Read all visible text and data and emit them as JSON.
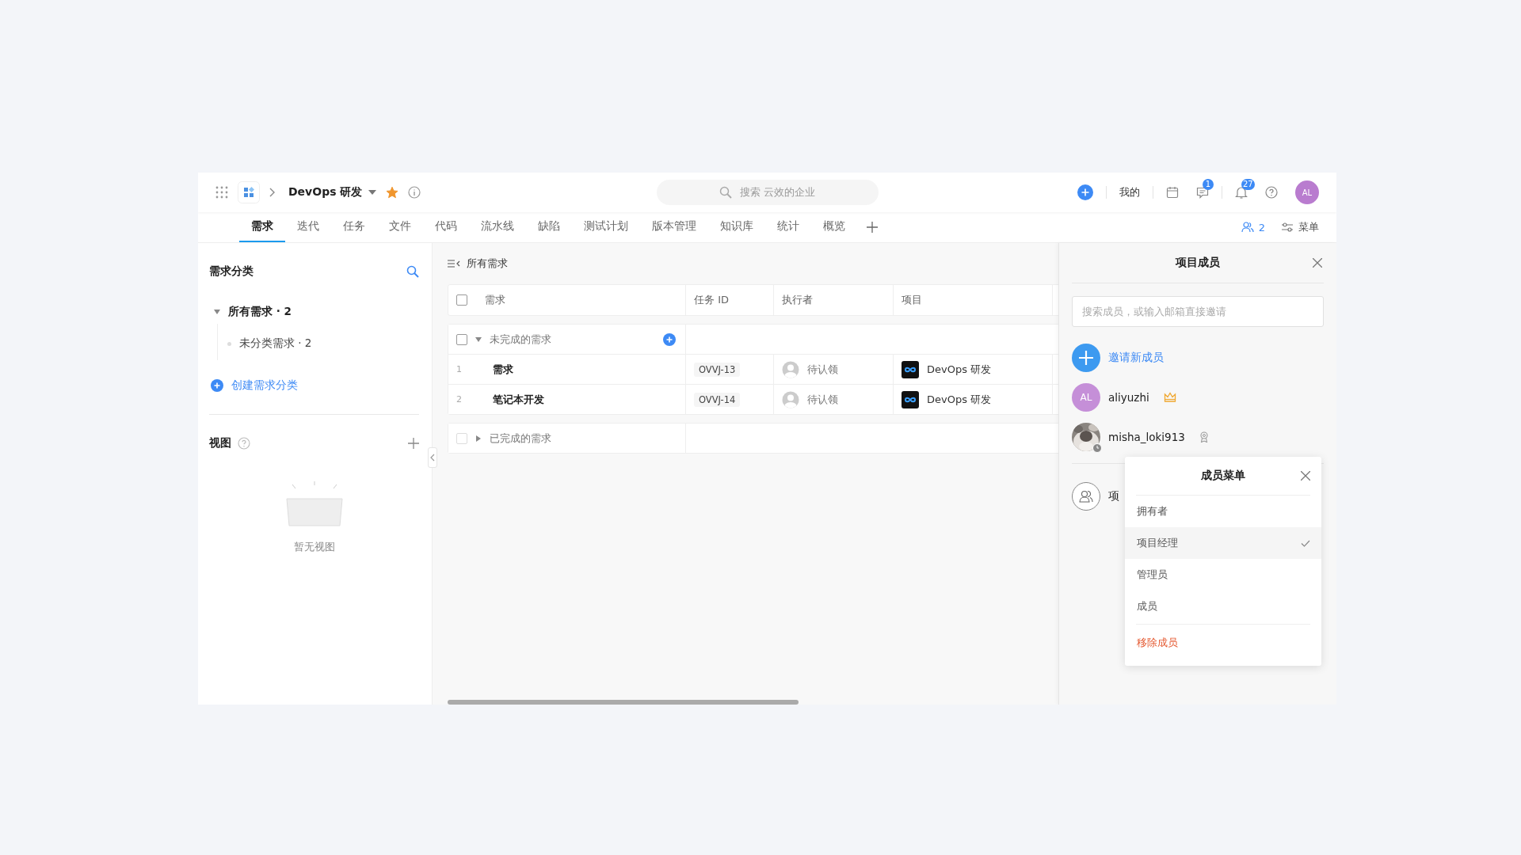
{
  "header": {
    "project": "DevOps 研发",
    "starred": true,
    "search_placeholder": "搜索 云效的企业",
    "my_label": "我的",
    "message_badge": "1",
    "notification_badge": "27",
    "avatar": "AL"
  },
  "tabs": [
    {
      "label": "需求",
      "selected": true
    },
    {
      "label": "迭代",
      "selected": false
    },
    {
      "label": "任务",
      "selected": false
    },
    {
      "label": "文件",
      "selected": false
    },
    {
      "label": "代码",
      "selected": false
    },
    {
      "label": "流水线",
      "selected": false
    },
    {
      "label": "缺陷",
      "selected": false
    },
    {
      "label": "测试计划",
      "selected": false
    },
    {
      "label": "版本管理",
      "selected": false
    },
    {
      "label": "知识库",
      "selected": false
    },
    {
      "label": "统计",
      "selected": false
    },
    {
      "label": "概览",
      "selected": false
    }
  ],
  "tab_tools": {
    "member_count": "2",
    "menu_label": "菜单"
  },
  "sidebar": {
    "title": "需求分类",
    "tree": [
      {
        "label": "所有需求 · 2",
        "expanded": true,
        "children": [
          {
            "label": "未分类需求 · 2"
          }
        ]
      }
    ],
    "create_label": "创建需求分类",
    "views_title": "视图",
    "views_empty": "暂无视图"
  },
  "main": {
    "title": "所有需求",
    "columns": [
      "需求",
      "任务 ID",
      "执行者",
      "项目"
    ],
    "all_checked": false,
    "groups": [
      {
        "label": "未完成的需求",
        "expanded": true,
        "checked": false,
        "rows": [
          {
            "index": "1",
            "title": "需求",
            "task_id": "OVVJ-13",
            "assignee": "待认领",
            "project": "DevOps 研发"
          },
          {
            "index": "2",
            "title": "笔记本开发",
            "task_id": "OVVJ-14",
            "assignee": "待认领",
            "project": "DevOps 研发"
          }
        ]
      },
      {
        "label": "已完成的需求",
        "expanded": false,
        "checked": false
      }
    ]
  },
  "members_panel": {
    "title": "项目成员",
    "search_placeholder": "搜索成员，或输入邮箱直接邀请",
    "invite_label": "邀请新成员",
    "members": [
      {
        "name": "aliyuzhi",
        "kind": "initials",
        "initials": "AL",
        "owner": true
      },
      {
        "name": "misha_loki913",
        "kind": "picture",
        "owner": false
      }
    ],
    "group_label": "项"
  },
  "member_menu": {
    "title": "成员菜单",
    "roles": [
      {
        "label": "拥有者",
        "selected": false
      },
      {
        "label": "项目经理",
        "selected": true
      },
      {
        "label": "管理员",
        "selected": false
      },
      {
        "label": "成员",
        "selected": false
      }
    ],
    "remove_label": "移除成员"
  }
}
